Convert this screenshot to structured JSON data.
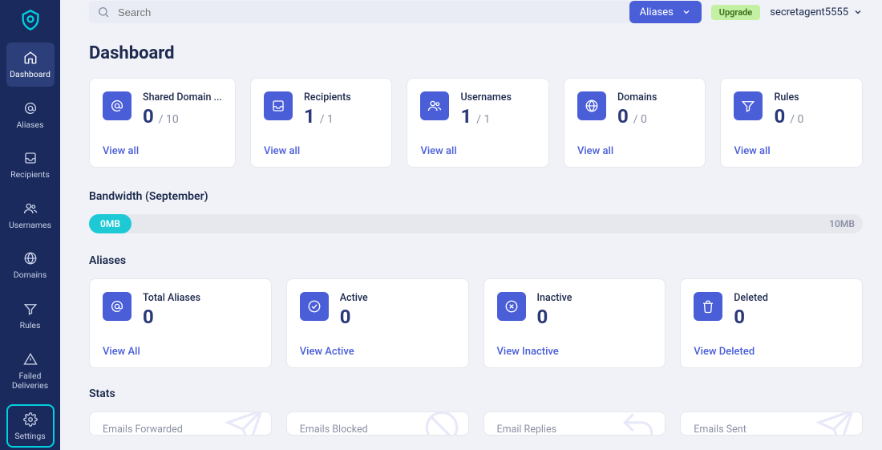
{
  "header": {
    "search_placeholder": "Search",
    "filter_label": "Aliases",
    "upgrade_label": "Upgrade",
    "username": "secretagent5555"
  },
  "sidebar": {
    "items": [
      {
        "label": "Dashboard"
      },
      {
        "label": "Aliases"
      },
      {
        "label": "Recipients"
      },
      {
        "label": "Usernames"
      },
      {
        "label": "Domains"
      },
      {
        "label": "Rules"
      },
      {
        "label": "Failed\nDeliveries"
      },
      {
        "label": "Settings"
      }
    ]
  },
  "page": {
    "title": "Dashboard"
  },
  "summary_cards": [
    {
      "label": "Shared Domain ...",
      "value": "0",
      "limit": "/ 10",
      "link": "View all"
    },
    {
      "label": "Recipients",
      "value": "1",
      "limit": "/ 1",
      "link": "View all"
    },
    {
      "label": "Usernames",
      "value": "1",
      "limit": "/ 1",
      "link": "View all"
    },
    {
      "label": "Domains",
      "value": "0",
      "limit": "/ 0",
      "link": "View all"
    },
    {
      "label": "Rules",
      "value": "0",
      "limit": "/ 0",
      "link": "View all"
    }
  ],
  "bandwidth": {
    "title": "Bandwidth (September)",
    "used_label": "0MB",
    "max_label": "10MB"
  },
  "aliases_section": {
    "title": "Aliases",
    "cards": [
      {
        "label": "Total Aliases",
        "value": "0",
        "link": "View All"
      },
      {
        "label": "Active",
        "value": "0",
        "link": "View Active"
      },
      {
        "label": "Inactive",
        "value": "0",
        "link": "View Inactive"
      },
      {
        "label": "Deleted",
        "value": "0",
        "link": "View Deleted"
      }
    ]
  },
  "stats_section": {
    "title": "Stats",
    "cards": [
      {
        "label": "Emails Forwarded"
      },
      {
        "label": "Emails Blocked"
      },
      {
        "label": "Email Replies"
      },
      {
        "label": "Emails Sent"
      }
    ]
  }
}
